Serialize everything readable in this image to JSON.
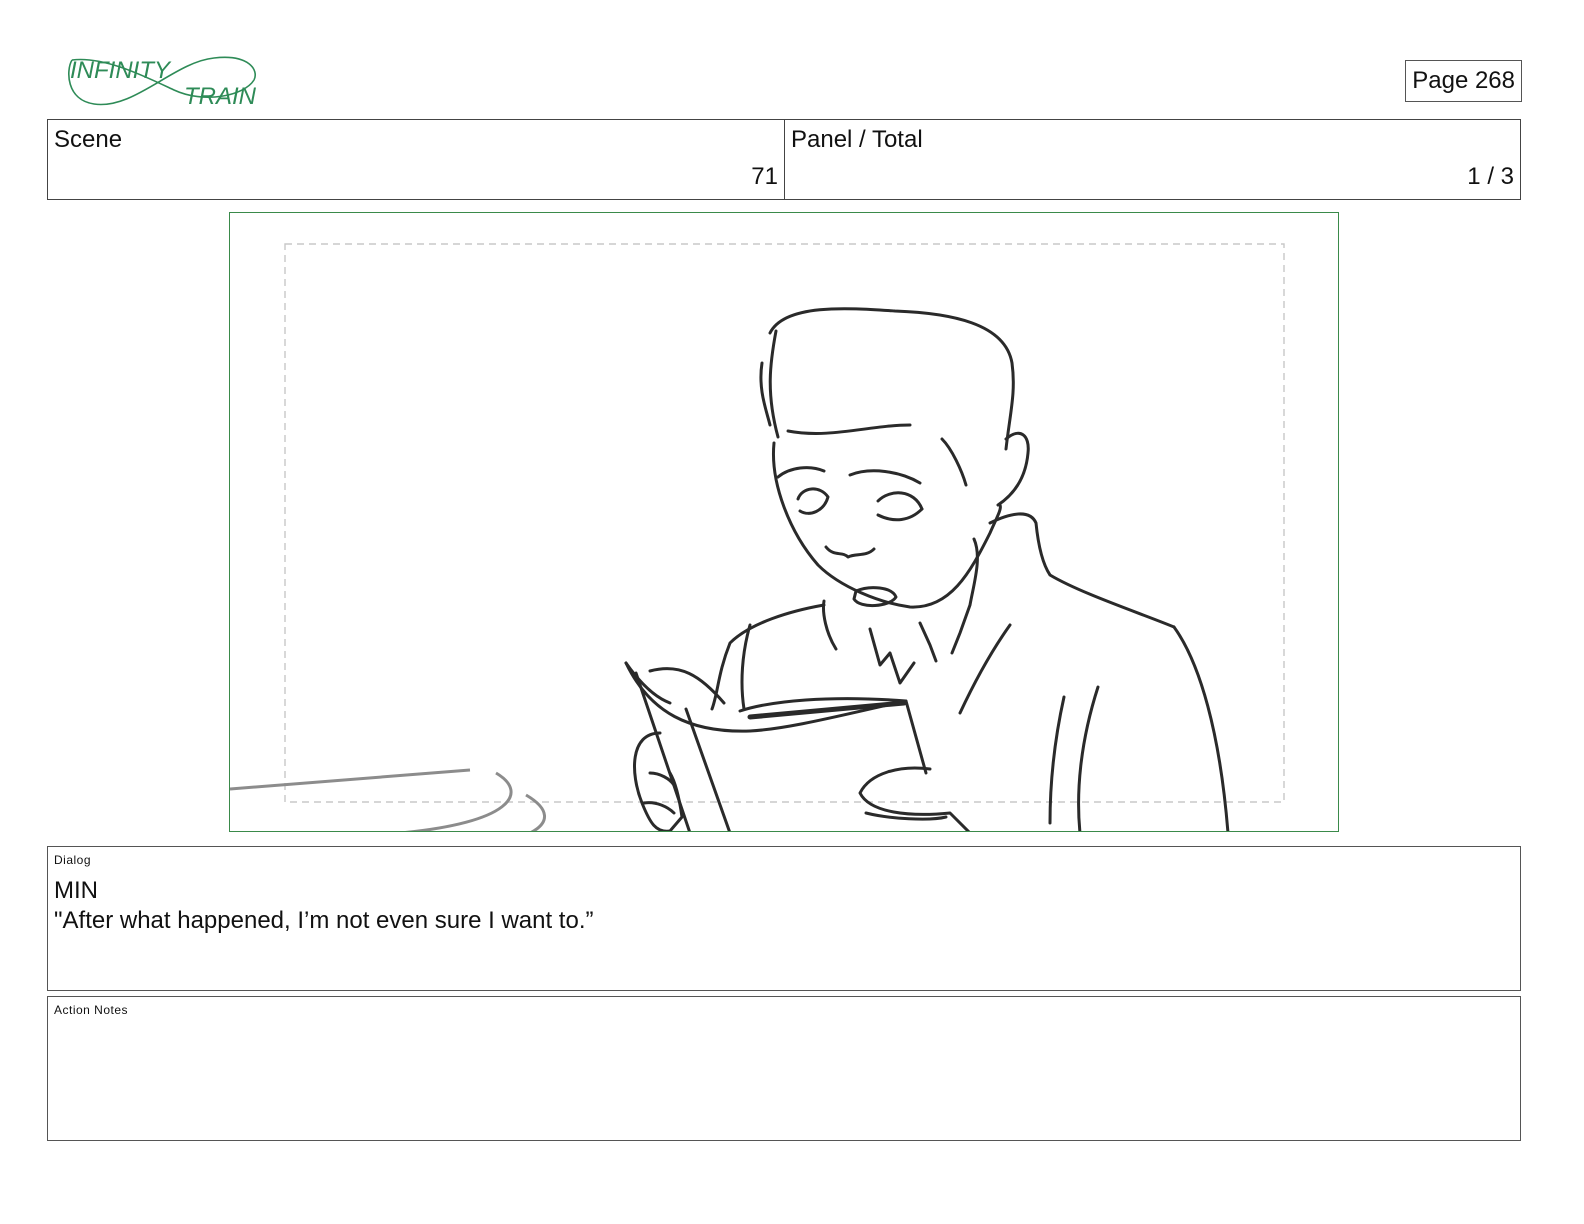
{
  "header": {
    "logo": {
      "line1": "INFINITY",
      "line2": "TRAIN",
      "color": "#2e8b57"
    },
    "page_label": "Page 268"
  },
  "info": {
    "scene_label": "Scene",
    "scene_value": "71",
    "panel_label": "Panel / Total",
    "panel_value": "1 / 3"
  },
  "panel_image": {
    "description_icon": "storyboard-sketch",
    "border_color": "#3a8a4a"
  },
  "dialog": {
    "label": "Dialog",
    "speaker": "MIN",
    "line": "\"After what happened, I’m not even sure I want to.”"
  },
  "action_notes": {
    "label": "Action Notes",
    "text": ""
  }
}
